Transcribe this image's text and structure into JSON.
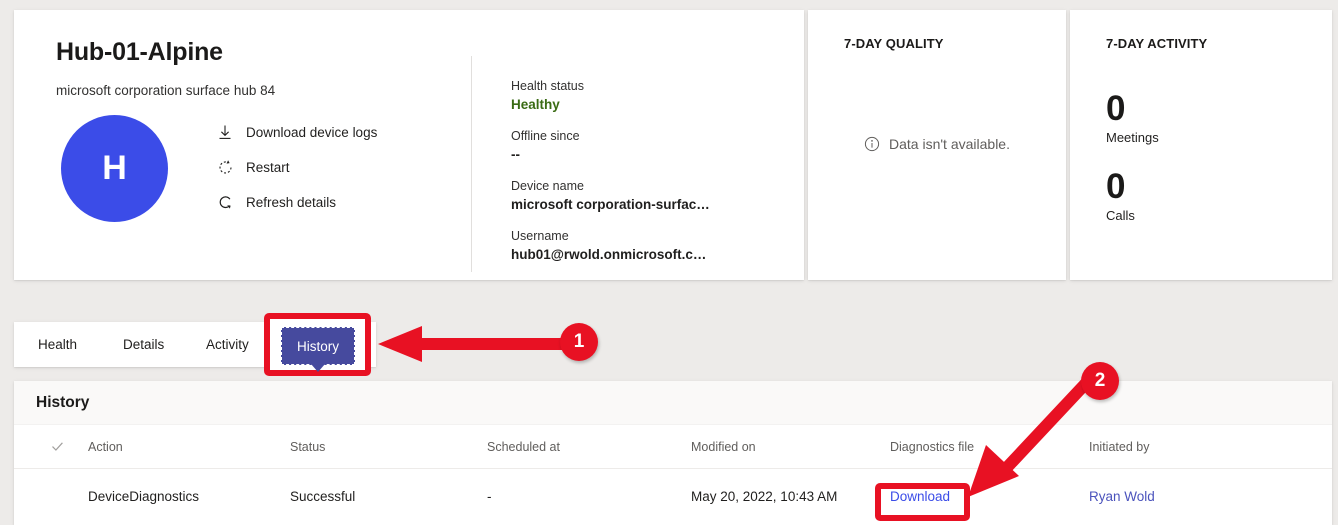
{
  "overview": {
    "title": "Hub-01-Alpine",
    "subtitle": "microsoft corporation surface hub 84",
    "avatar_initial": "H",
    "avatar_color": "#3b4ce8",
    "actions": [
      {
        "label": "Download device logs",
        "icon": "download-icon"
      },
      {
        "label": "Restart",
        "icon": "restart-icon"
      },
      {
        "label": "Refresh details",
        "icon": "refresh-icon"
      }
    ],
    "facts": [
      {
        "label": "Health status",
        "value": "Healthy",
        "state": "healthy"
      },
      {
        "label": "Offline since",
        "value": "--",
        "state": ""
      },
      {
        "label": "Device name",
        "value": "microsoft corporation-surfac…",
        "state": ""
      },
      {
        "label": "Username",
        "value": "hub01@rwold.onmicrosoft.c…",
        "state": ""
      }
    ]
  },
  "quality_card": {
    "heading": "7-DAY QUALITY",
    "empty_message": "Data isn't available.",
    "empty_icon": "info-icon"
  },
  "activity_card": {
    "heading": "7-DAY ACTIVITY",
    "metrics": [
      {
        "value": "0",
        "caption": "Meetings"
      },
      {
        "value": "0",
        "caption": "Calls"
      }
    ]
  },
  "tabs": {
    "items": [
      {
        "label": "Health",
        "selected": false
      },
      {
        "label": "Details",
        "selected": false
      },
      {
        "label": "Activity",
        "selected": false
      }
    ],
    "selected": {
      "label": "History",
      "selected": true
    }
  },
  "history": {
    "panel_title": "History",
    "select_all_icon": "checkmark-icon",
    "columns": [
      "Action",
      "Status",
      "Scheduled at",
      "Modified on",
      "Diagnostics file",
      "Initiated by"
    ],
    "rows": [
      {
        "action": "DeviceDiagnostics",
        "status": "Successful",
        "scheduled_at": "-",
        "modified_on": "May 20, 2022, 10:43 AM",
        "diagnostics_file": "Download",
        "initiated_by": "Ryan Wold"
      }
    ]
  },
  "annotations": {
    "accent_color": "#e81123",
    "markers": [
      {
        "number": "1",
        "target": "History tab"
      },
      {
        "number": "2",
        "target": "Download link"
      }
    ]
  }
}
